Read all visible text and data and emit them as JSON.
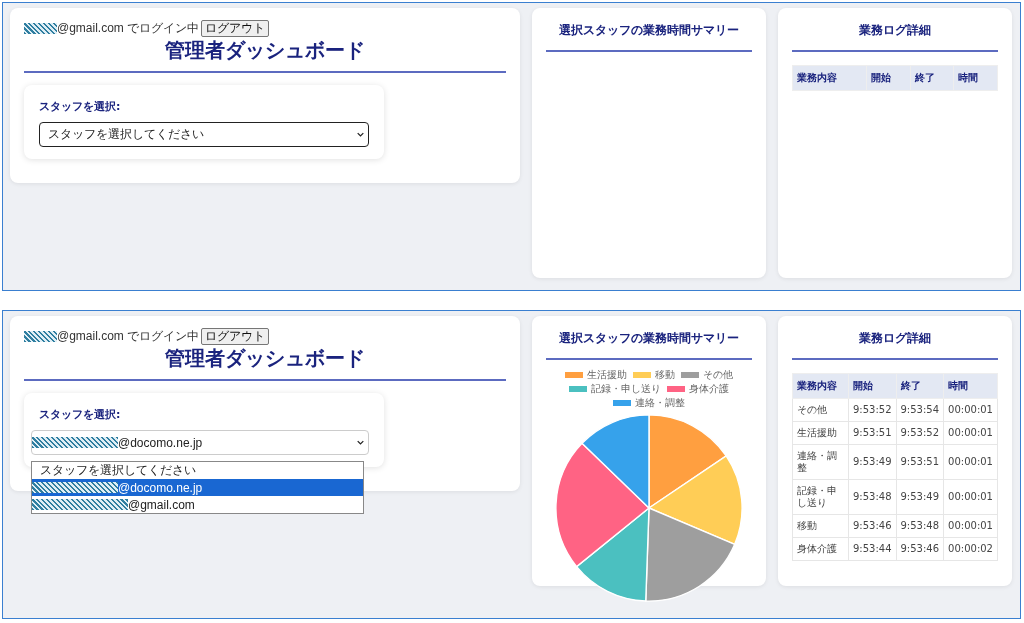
{
  "screens": [
    {
      "login": {
        "email": "@gmail.com",
        "masked": true,
        "status": "でログイン中",
        "logout": "ログアウト"
      },
      "title": "管理者ダッシュボード",
      "staff_select": {
        "label": "スタッフを選択:",
        "value": "スタッフを選択してください",
        "open": false
      },
      "summary": {
        "title": "選択スタッフの業務時間サマリー"
      },
      "log": {
        "title": "業務ログ詳細",
        "columns": [
          "業務内容",
          "開始",
          "終了",
          "時間"
        ]
      }
    },
    {
      "login": {
        "email": "@gmail.com",
        "masked": true,
        "status": "でログイン中",
        "logout": "ログアウト"
      },
      "title": "管理者ダッシュボード",
      "staff_select": {
        "label": "スタッフを選択:",
        "value": "@docomo.ne.jp",
        "value_masked": true,
        "open": true,
        "options": [
          {
            "text": "スタッフを選択してください",
            "masked": false,
            "selected": false
          },
          {
            "text": "@docomo.ne.jp",
            "masked": true,
            "selected": true
          },
          {
            "text": "@gmail.com",
            "masked": true,
            "selected": false
          }
        ]
      },
      "summary": {
        "title": "選択スタッフの業務時間サマリー",
        "legend": [
          {
            "label": "生活援助",
            "color": "#ff9f40"
          },
          {
            "label": "移動",
            "color": "#ffcd56"
          },
          {
            "label": "その他",
            "color": "#9e9e9e"
          },
          {
            "label": "記録・申し送り",
            "color": "#4bc0c0"
          },
          {
            "label": "身体介護",
            "color": "#ff6384"
          },
          {
            "label": "連絡・調整",
            "color": "#36a2eb"
          }
        ]
      },
      "log": {
        "title": "業務ログ詳細",
        "columns": [
          "業務内容",
          "開始",
          "終了",
          "時間"
        ],
        "rows": [
          [
            "その他",
            "9:53:52",
            "9:53:54",
            "00:00:01"
          ],
          [
            "生活援助",
            "9:53:51",
            "9:53:52",
            "00:00:01"
          ],
          [
            "連絡・調整",
            "9:53:49",
            "9:53:51",
            "00:00:01"
          ],
          [
            "記録・申し送り",
            "9:53:48",
            "9:53:49",
            "00:00:01"
          ],
          [
            "移動",
            "9:53:46",
            "9:53:48",
            "00:00:01"
          ],
          [
            "身体介護",
            "9:53:44",
            "9:53:46",
            "00:00:02"
          ]
        ]
      }
    }
  ]
}
